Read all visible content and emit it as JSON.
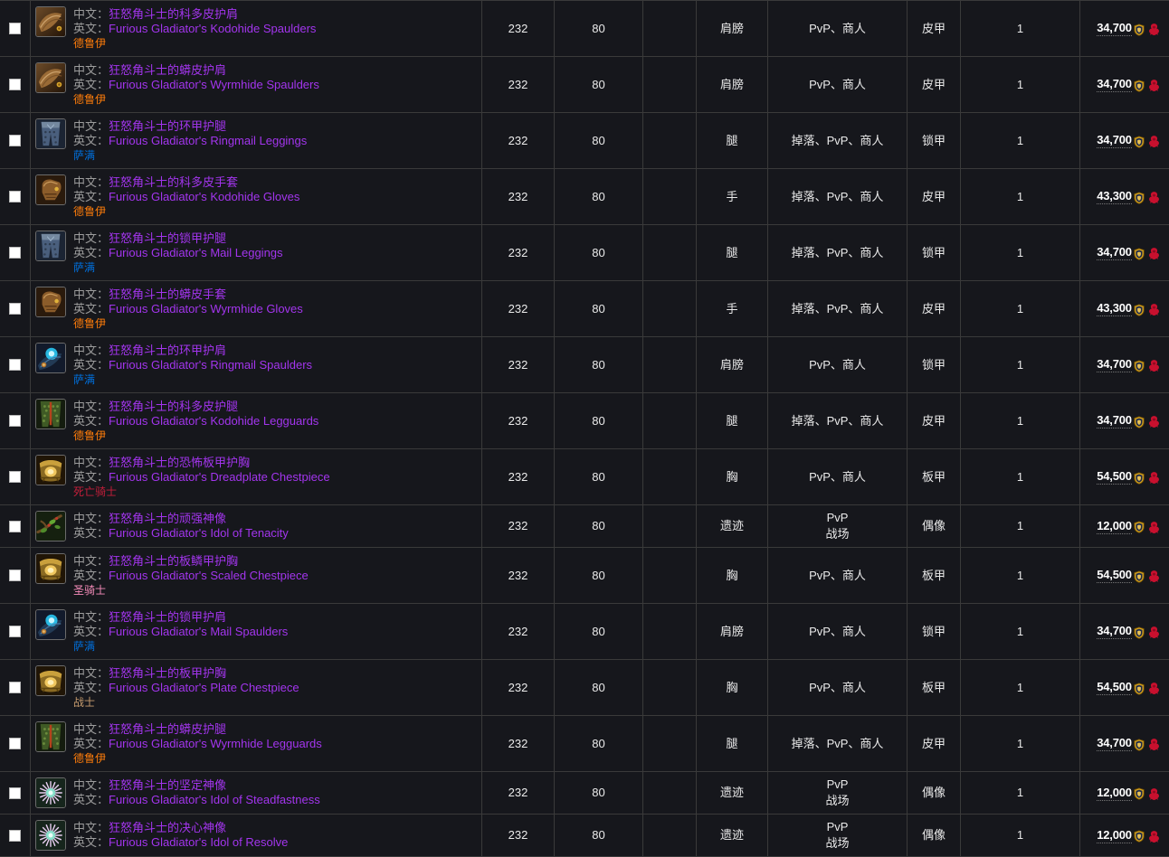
{
  "labels": {
    "zh_prefix": "中文：",
    "en_prefix": "英文：",
    "checkbox_name": "row-select-checkbox",
    "currency_icon": "arena-points-icon",
    "faction_icon": "horde-faction-icon"
  },
  "colors": {
    "epic": "#a335ee",
    "druid": "#ff7d0a",
    "shaman": "#0070de",
    "death_knight": "#c41e3a",
    "paladin": "#f58cba",
    "warrior": "#c79c6e",
    "background": "#16171c",
    "border": "#3a3a3a"
  },
  "rows": [
    {
      "zh": "狂怒角斗士的科多皮护肩",
      "en": "Furious Gladiator's Kodohide Spaulders",
      "cls": "德鲁伊",
      "cls_key": "druid",
      "icon": "shoulder-leather-icon",
      "ilvl": "232",
      "level": "80",
      "blank": "",
      "slot": "肩膀",
      "source": "PvP、商人",
      "armor": "皮甲",
      "qty": "1",
      "price": "34,700"
    },
    {
      "zh": "狂怒角斗士的蟒皮护肩",
      "en": "Furious Gladiator's Wyrmhide Spaulders",
      "cls": "德鲁伊",
      "cls_key": "druid",
      "icon": "shoulder-leather-icon",
      "ilvl": "232",
      "level": "80",
      "blank": "",
      "slot": "肩膀",
      "source": "PvP、商人",
      "armor": "皮甲",
      "qty": "1",
      "price": "34,700"
    },
    {
      "zh": "狂怒角斗士的环甲护腿",
      "en": "Furious Gladiator's Ringmail Leggings",
      "cls": "萨满",
      "cls_key": "shaman",
      "icon": "legs-mail-icon",
      "ilvl": "232",
      "level": "80",
      "blank": "",
      "slot": "腿",
      "source": "掉落、PvP、商人",
      "armor": "锁甲",
      "qty": "1",
      "price": "34,700"
    },
    {
      "zh": "狂怒角斗士的科多皮手套",
      "en": "Furious Gladiator's Kodohide Gloves",
      "cls": "德鲁伊",
      "cls_key": "druid",
      "icon": "gloves-leather-icon",
      "ilvl": "232",
      "level": "80",
      "blank": "",
      "slot": "手",
      "source": "掉落、PvP、商人",
      "armor": "皮甲",
      "qty": "1",
      "price": "43,300"
    },
    {
      "zh": "狂怒角斗士的锁甲护腿",
      "en": "Furious Gladiator's Mail Leggings",
      "cls": "萨满",
      "cls_key": "shaman",
      "icon": "legs-mail-icon",
      "ilvl": "232",
      "level": "80",
      "blank": "",
      "slot": "腿",
      "source": "掉落、PvP、商人",
      "armor": "锁甲",
      "qty": "1",
      "price": "34,700"
    },
    {
      "zh": "狂怒角斗士的蟒皮手套",
      "en": "Furious Gladiator's Wyrmhide Gloves",
      "cls": "德鲁伊",
      "cls_key": "druid",
      "icon": "gloves-leather-icon",
      "ilvl": "232",
      "level": "80",
      "blank": "",
      "slot": "手",
      "source": "掉落、PvP、商人",
      "armor": "皮甲",
      "qty": "1",
      "price": "43,300"
    },
    {
      "zh": "狂怒角斗士的环甲护肩",
      "en": "Furious Gladiator's Ringmail Spaulders",
      "cls": "萨满",
      "cls_key": "shaman",
      "icon": "shoulder-mail-icon",
      "ilvl": "232",
      "level": "80",
      "blank": "",
      "slot": "肩膀",
      "source": "PvP、商人",
      "armor": "锁甲",
      "qty": "1",
      "price": "34,700"
    },
    {
      "zh": "狂怒角斗士的科多皮护腿",
      "en": "Furious Gladiator's Kodohide Legguards",
      "cls": "德鲁伊",
      "cls_key": "druid",
      "icon": "legs-leather-icon",
      "ilvl": "232",
      "level": "80",
      "blank": "",
      "slot": "腿",
      "source": "掉落、PvP、商人",
      "armor": "皮甲",
      "qty": "1",
      "price": "34,700"
    },
    {
      "zh": "狂怒角斗士的恐怖板甲护胸",
      "en": "Furious Gladiator's Dreadplate Chestpiece",
      "cls": "死亡骑士",
      "cls_key": "death_knight",
      "icon": "chest-plate-icon",
      "ilvl": "232",
      "level": "80",
      "blank": "",
      "slot": "胸",
      "source": "PvP、商人",
      "armor": "板甲",
      "qty": "1",
      "price": "54,500"
    },
    {
      "zh": "狂怒角斗士的顽强神像",
      "en": "Furious Gladiator's Idol of Tenacity",
      "cls": "",
      "cls_key": "",
      "icon": "idol-branch-icon",
      "ilvl": "232",
      "level": "80",
      "blank": "",
      "slot": "遗迹",
      "source": "PvP\n战场",
      "armor": "偶像",
      "qty": "1",
      "price": "12,000"
    },
    {
      "zh": "狂怒角斗士的板鳞甲护胸",
      "en": "Furious Gladiator's Scaled Chestpiece",
      "cls": "圣骑士",
      "cls_key": "paladin",
      "icon": "chest-plate-icon",
      "ilvl": "232",
      "level": "80",
      "blank": "",
      "slot": "胸",
      "source": "PvP、商人",
      "armor": "板甲",
      "qty": "1",
      "price": "54,500"
    },
    {
      "zh": "狂怒角斗士的锁甲护肩",
      "en": "Furious Gladiator's Mail Spaulders",
      "cls": "萨满",
      "cls_key": "shaman",
      "icon": "shoulder-mail-icon",
      "ilvl": "232",
      "level": "80",
      "blank": "",
      "slot": "肩膀",
      "source": "PvP、商人",
      "armor": "锁甲",
      "qty": "1",
      "price": "34,700"
    },
    {
      "zh": "狂怒角斗士的板甲护胸",
      "en": "Furious Gladiator's Plate Chestpiece",
      "cls": "战士",
      "cls_key": "warrior",
      "icon": "chest-plate-icon",
      "ilvl": "232",
      "level": "80",
      "blank": "",
      "slot": "胸",
      "source": "PvP、商人",
      "armor": "板甲",
      "qty": "1",
      "price": "54,500"
    },
    {
      "zh": "狂怒角斗士的蟒皮护腿",
      "en": "Furious Gladiator's Wyrmhide Legguards",
      "cls": "德鲁伊",
      "cls_key": "druid",
      "icon": "legs-leather-icon",
      "ilvl": "232",
      "level": "80",
      "blank": "",
      "slot": "腿",
      "source": "掉落、PvP、商人",
      "armor": "皮甲",
      "qty": "1",
      "price": "34,700"
    },
    {
      "zh": "狂怒角斗士的坚定神像",
      "en": "Furious Gladiator's Idol of Steadfastness",
      "cls": "",
      "cls_key": "",
      "icon": "idol-bloom-icon",
      "ilvl": "232",
      "level": "80",
      "blank": "",
      "slot": "遗迹",
      "source": "PvP\n战场",
      "armor": "偶像",
      "qty": "1",
      "price": "12,000"
    },
    {
      "zh": "狂怒角斗士的决心神像",
      "en": "Furious Gladiator's Idol of Resolve",
      "cls": "",
      "cls_key": "",
      "icon": "idol-bloom-icon",
      "ilvl": "232",
      "level": "80",
      "blank": "",
      "slot": "遗迹",
      "source": "PvP\n战场",
      "armor": "偶像",
      "qty": "1",
      "price": "12,000"
    }
  ]
}
